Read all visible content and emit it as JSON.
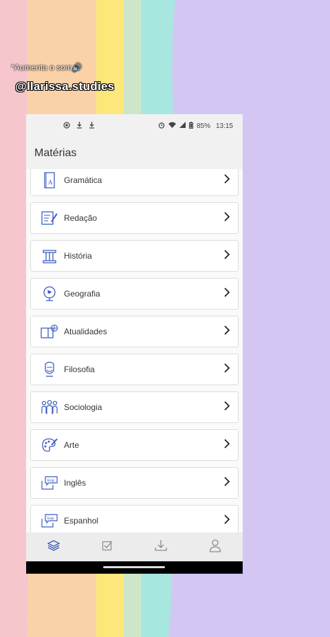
{
  "overlay": {
    "caption": "*Aumenta o som🔊",
    "handle": "@llarissa.studies"
  },
  "statusbar": {
    "battery": "85%",
    "time": "13:15"
  },
  "appbar": {
    "title": "Matérias"
  },
  "subjects": [
    {
      "label": "Gramática",
      "icon": "grammar-book-icon"
    },
    {
      "label": "Redação",
      "icon": "writing-icon"
    },
    {
      "label": "História",
      "icon": "column-icon"
    },
    {
      "label": "Geografia",
      "icon": "globe-icon"
    },
    {
      "label": "Atualidades",
      "icon": "book-globe-icon"
    },
    {
      "label": "Filosofia",
      "icon": "philosopher-icon"
    },
    {
      "label": "Sociologia",
      "icon": "people-icon"
    },
    {
      "label": "Arte",
      "icon": "palette-icon"
    },
    {
      "label": "Inglês",
      "icon": "english-chat-icon"
    },
    {
      "label": "Espanhol",
      "icon": "spanish-chat-icon"
    }
  ],
  "icon_tags": {
    "english": "Eng",
    "spanish": "Esp",
    "grammar": "A"
  },
  "colors": {
    "accent": "#3a5bbf",
    "nav_inactive": "#8a8a8a"
  }
}
